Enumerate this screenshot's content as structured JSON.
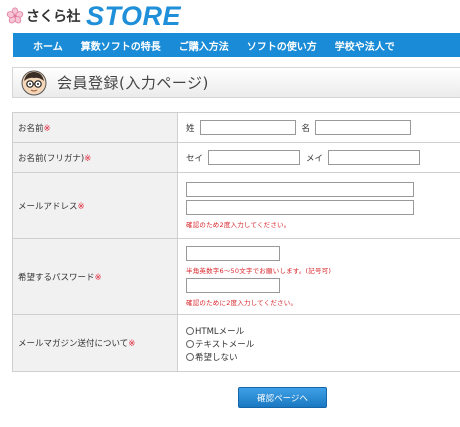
{
  "brand": {
    "name": "さくら社",
    "store": "STORE",
    "accent": "#1a8bd6",
    "logo_icon": "sakura-icon"
  },
  "nav": {
    "items": [
      "ホーム",
      "算数ソフトの特長",
      "ご購入方法",
      "ソフトの使い方",
      "学校や法人で"
    ]
  },
  "page": {
    "title": "会員登録(入力ページ)",
    "icon": "face-glasses-icon"
  },
  "form": {
    "required_mark": "※",
    "name": {
      "label": "お名前",
      "sei": "姓",
      "mei": "名",
      "sei_value": "",
      "mei_value": ""
    },
    "kana": {
      "label": "お名前(フリガナ)",
      "sei": "セイ",
      "mei": "メイ",
      "sei_value": "",
      "mei_value": ""
    },
    "email": {
      "label": "メールアドレス",
      "value": "",
      "confirm_value": "",
      "hint": "確認のため2度入力してください。"
    },
    "password": {
      "label": "希望するパスワード",
      "rule_hint": "半角英数字6～50文字でお願いします。(記号可)",
      "confirm_hint": "確認のために2度入力してください。"
    },
    "newsletter": {
      "label": "メールマガジン送付について",
      "options": [
        "HTMLメール",
        "テキストメール",
        "希望しない"
      ]
    }
  },
  "submit": {
    "label": "確認ページへ"
  }
}
